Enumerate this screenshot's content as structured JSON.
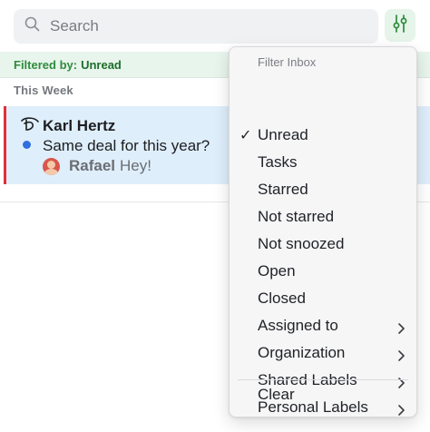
{
  "search": {
    "placeholder": "Search"
  },
  "filter_bar": {
    "prefix": "Filtered by:",
    "value": "Unread"
  },
  "section": {
    "title": "This Week"
  },
  "conversation": {
    "sender": "Karl Hertz",
    "subject": "Same deal for this year?",
    "last_author": "Rafael",
    "last_message": "Hey!",
    "unread": true
  },
  "menu": {
    "title": "Filter Inbox",
    "items": [
      {
        "label": "Unread",
        "checked": true,
        "submenu": false
      },
      {
        "label": "Tasks",
        "checked": false,
        "submenu": false
      },
      {
        "label": "Starred",
        "checked": false,
        "submenu": false
      },
      {
        "label": "Not starred",
        "checked": false,
        "submenu": false
      },
      {
        "label": "Not snoozed",
        "checked": false,
        "submenu": false
      },
      {
        "label": "Open",
        "checked": false,
        "submenu": false
      },
      {
        "label": "Closed",
        "checked": false,
        "submenu": false
      },
      {
        "label": "Assigned to",
        "checked": false,
        "submenu": true
      },
      {
        "label": "Organization",
        "checked": false,
        "submenu": true
      },
      {
        "label": "Shared Labels",
        "checked": false,
        "submenu": true
      },
      {
        "label": "Personal Labels",
        "checked": false,
        "submenu": true
      }
    ],
    "clear_label": "Clear",
    "check_glyph": "✓"
  },
  "colors": {
    "accent_green": "#2e8b3d",
    "selected_row": "#dfeefb",
    "unread_dot": "#2f6fe0",
    "priority_bar": "#e0303a"
  }
}
